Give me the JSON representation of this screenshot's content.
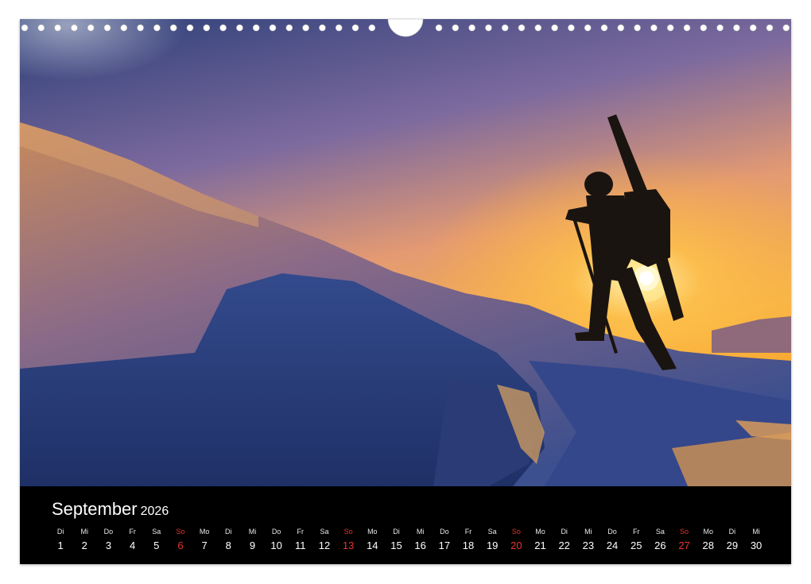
{
  "calendar": {
    "month": "September",
    "year": "2026",
    "sunday_color": "#e8332b",
    "days": [
      {
        "dow": "Di",
        "num": "1"
      },
      {
        "dow": "Mi",
        "num": "2"
      },
      {
        "dow": "Do",
        "num": "3"
      },
      {
        "dow": "Fr",
        "num": "4"
      },
      {
        "dow": "Sa",
        "num": "5"
      },
      {
        "dow": "So",
        "num": "6"
      },
      {
        "dow": "Mo",
        "num": "7"
      },
      {
        "dow": "Di",
        "num": "8"
      },
      {
        "dow": "Mi",
        "num": "9"
      },
      {
        "dow": "Do",
        "num": "10"
      },
      {
        "dow": "Fr",
        "num": "11"
      },
      {
        "dow": "Sa",
        "num": "12"
      },
      {
        "dow": "So",
        "num": "13"
      },
      {
        "dow": "Mo",
        "num": "14"
      },
      {
        "dow": "Di",
        "num": "15"
      },
      {
        "dow": "Mi",
        "num": "16"
      },
      {
        "dow": "Do",
        "num": "17"
      },
      {
        "dow": "Fr",
        "num": "18"
      },
      {
        "dow": "Sa",
        "num": "19"
      },
      {
        "dow": "So",
        "num": "20"
      },
      {
        "dow": "Mo",
        "num": "21"
      },
      {
        "dow": "Di",
        "num": "22"
      },
      {
        "dow": "Mi",
        "num": "23"
      },
      {
        "dow": "Do",
        "num": "24"
      },
      {
        "dow": "Fr",
        "num": "25"
      },
      {
        "dow": "Sa",
        "num": "26"
      },
      {
        "dow": "So",
        "num": "27"
      },
      {
        "dow": "Mo",
        "num": "28"
      },
      {
        "dow": "Di",
        "num": "29"
      },
      {
        "dow": "Mi",
        "num": "30"
      }
    ]
  },
  "photo": {
    "subject": "skier-silhouette-climbing-snow-slope-at-sunset"
  }
}
